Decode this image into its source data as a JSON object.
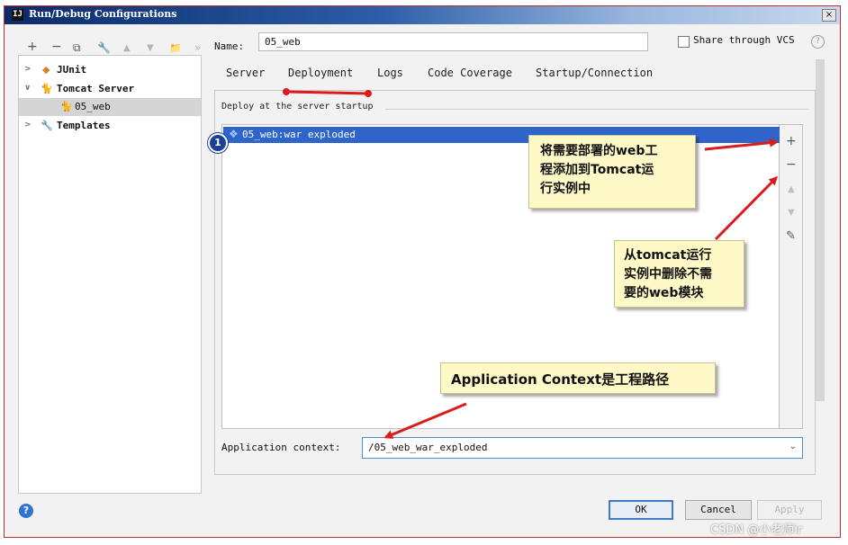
{
  "window": {
    "title": "Run/Debug Configurations",
    "close_label": "×"
  },
  "toolbar": {
    "add": "+",
    "remove": "−",
    "copy": "⧉",
    "edit": "🔧",
    "up": "▲",
    "down": "▼",
    "folder": "📁",
    "more": "»"
  },
  "tree": {
    "items": [
      {
        "label": "JUnit",
        "arrow": ">",
        "icon": "◆"
      },
      {
        "label": "Tomcat Server",
        "arrow": "∨",
        "icon": "🐈"
      },
      {
        "label": "05_web",
        "icon": "🐈"
      },
      {
        "label": "Templates",
        "arrow": ">",
        "icon": "🔧"
      }
    ]
  },
  "name_field": {
    "label": "Name:",
    "value": "05_web"
  },
  "share": {
    "label": "Share through VCS",
    "help": "?"
  },
  "tabs": [
    "Server",
    "Deployment",
    "Logs",
    "Code Coverage",
    "Startup/Connection"
  ],
  "deployment": {
    "section_title": "Deploy at the server startup",
    "artifact": "05_web:war exploded",
    "side_buttons": {
      "add": "+",
      "remove": "−",
      "up": "▲",
      "down": "▼",
      "edit": "✎"
    }
  },
  "context": {
    "label": "Application context:",
    "value": "/05_web_war_exploded",
    "chevron": "⌄"
  },
  "footer": {
    "help": "?",
    "ok": "OK",
    "cancel": "Cancel",
    "apply": "Apply"
  },
  "annotations": {
    "badge": "1",
    "callout_add": [
      "将需要部署的web工",
      "程添加到Tomcat运",
      "行实例中"
    ],
    "callout_remove": [
      "从tomcat运行",
      "实例中删除不需",
      "要的web模块"
    ],
    "callout_context": "Application Context是工程路径"
  },
  "watermark": "CSDN @小老师ir",
  "colors": {
    "selection": "#2f65ca",
    "annotation_arrow": "#d91c1c",
    "callout_bg": "#fff9c7",
    "focus_border": "#3d7ac9"
  }
}
